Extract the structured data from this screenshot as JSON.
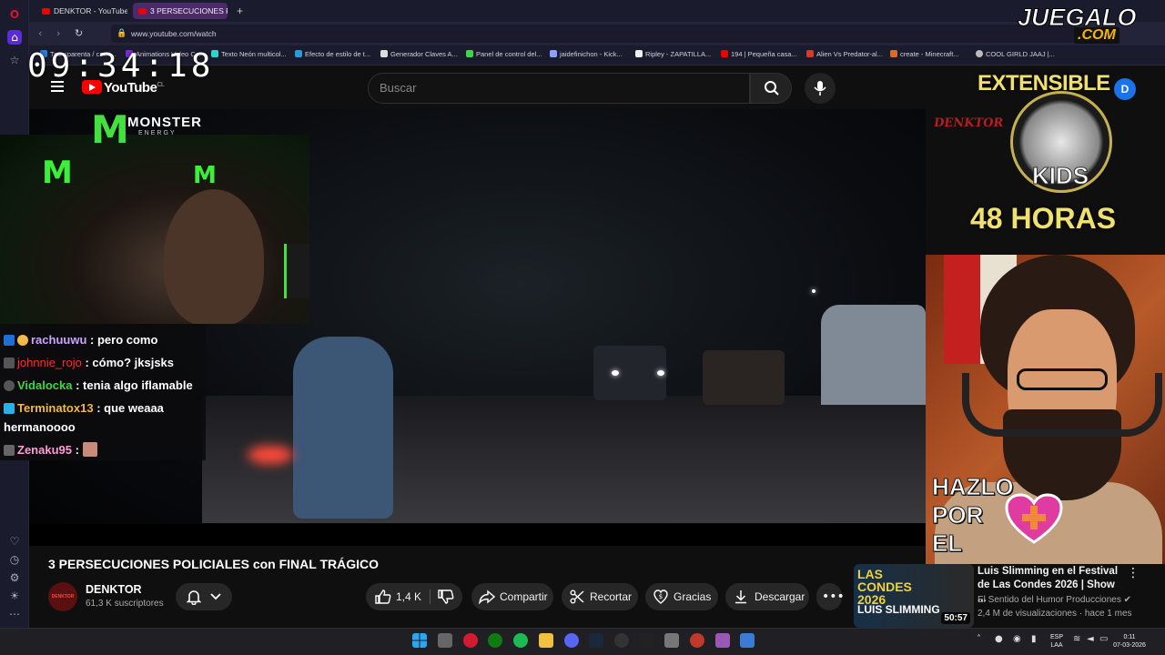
{
  "browser": {
    "tabs": [
      {
        "label": "DENKTOR - YouTube"
      },
      {
        "label": "3 PERSECUCIONES PC"
      }
    ],
    "url": "www.youtube.com/watch",
    "bookmarks": [
      "Transparenta / cami...",
      "Animations Video C...",
      "Texto Neón multicol...",
      "Efecto de estilo de t...",
      "Generador Claves A...",
      "Panel de control del...",
      "jaidefinichon - Kick...",
      "Ripley - ZAPATILLA...",
      "194 | Pequeña casa...",
      "Alien Vs Predator-al...",
      "create - Minecraft...",
      "COOL GIRLD JAAJ |..."
    ]
  },
  "youtube": {
    "logo_text": "YouTube",
    "country": "CL",
    "search_placeholder": "Buscar",
    "avatar_letter": "D"
  },
  "overlay": {
    "clock": "09:34:18",
    "monster_brand": "MONSTER",
    "monster_sub": "ENERGY",
    "denktor_logo": "DENKTOR",
    "promo_top": "EXTENSIBLE",
    "promo_mid": "KIDS",
    "promo_bottom": "48 HORAS",
    "hazlo": [
      "HAZLO",
      "POR",
      "EL"
    ],
    "watermark_1": "JUEGALO",
    "watermark_2": ".COM"
  },
  "chat": [
    {
      "user": "rachuuwu",
      "color": "#c9a4ff",
      "message": ": pero como",
      "wrap": false
    },
    {
      "user": "johnnie_rojo",
      "color": "#ff2b2b",
      "message": ": cómo? jksjsks",
      "wrap": false
    },
    {
      "user": "Vidalocka",
      "color": "#3cd54b",
      "message": ": tenia algo iflamable",
      "wrap": false
    },
    {
      "user": "Terminatox13",
      "color": "#f2b84b",
      "message": ": que weaaa",
      "cont": "hermanoooo"
    },
    {
      "user": "Zenaku95",
      "color": "#ff9bd6",
      "message": ":",
      "emote": true
    }
  ],
  "video": {
    "title": "3 PERSECUCIONES POLICIALES con FINAL TRÁGICO",
    "channel": "DENKTOR",
    "subscribers": "61,3 K suscriptores",
    "likes": "1,4 K",
    "share": "Compartir",
    "clip": "Recortar",
    "thanks": "Gracias",
    "download": "Descargar"
  },
  "recommended": {
    "title": "Luis Slimming en el Festival de Las Condes 2026 | Show ...",
    "channel": "El Sentido del Humor Producciones",
    "meta": "2,4 M de visualizaciones · hace 1 mes",
    "duration": "50:57",
    "thumb_top": "LAS CONDES 2026",
    "thumb_bottom": "LUIS SLIMMING"
  },
  "taskbar": {
    "lang_1": "ESP",
    "lang_2": "LAA",
    "time": "0:11",
    "date": "07-03-2026"
  }
}
